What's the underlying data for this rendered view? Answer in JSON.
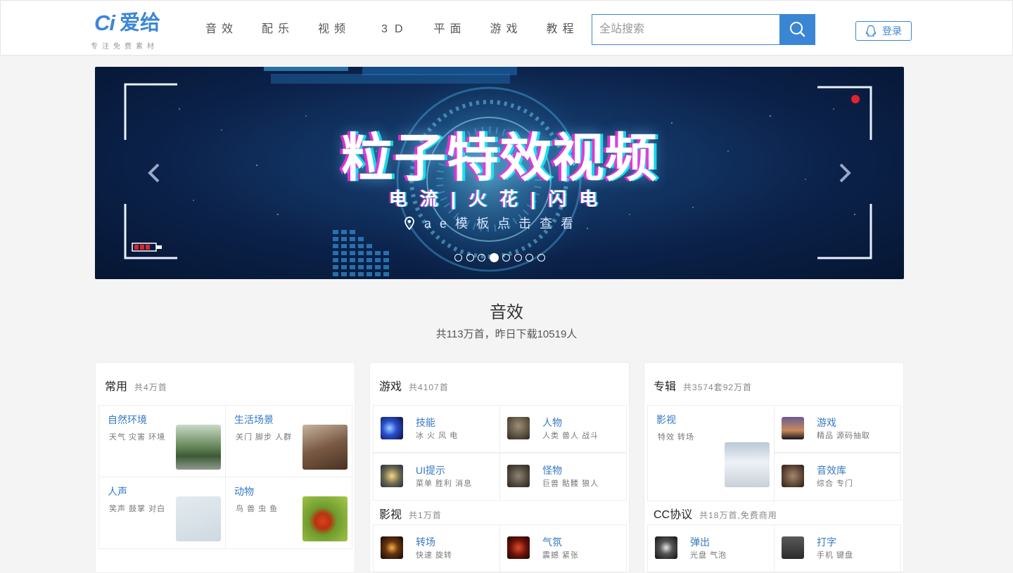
{
  "brand": {
    "mark": "Ci",
    "name": "爱给",
    "slogan": "专注免费素材"
  },
  "nav": [
    "音效",
    "配乐",
    "视频",
    "3D",
    "平面",
    "游戏",
    "教程"
  ],
  "search": {
    "placeholder": "全站搜索",
    "value": ""
  },
  "login_label": "登录",
  "banner": {
    "title": "粒子特效视频",
    "subtitle": "电流|火花|闪电",
    "location_text": "ae模板点击查看",
    "dot_count": 8,
    "active_dot": 4
  },
  "section": {
    "title": "音效",
    "subtitle": "共113万首，昨日下载10519人"
  },
  "cards": {
    "common": {
      "title": "常用",
      "count": "共4万首",
      "items": [
        {
          "name": "自然环境",
          "desc": "天气 灾害 环境"
        },
        {
          "name": "生活场景",
          "desc": "关门 脚步 人群"
        },
        {
          "name": "人声",
          "desc": "笑声 鼓掌 对白"
        },
        {
          "name": "动物",
          "desc": "鸟 兽 虫 鱼"
        }
      ]
    },
    "game": {
      "title": "游戏",
      "count": "共4107首",
      "items": [
        {
          "name": "技能",
          "desc": "冰 火 风 电"
        },
        {
          "name": "人物",
          "desc": "人类 兽人 战斗"
        },
        {
          "name": "UI提示",
          "desc": "菜单 胜利 消息"
        },
        {
          "name": "怪物",
          "desc": "巨兽 骷髅 狼人"
        }
      ],
      "sub_title": "影视",
      "sub_count": "共1万首",
      "sub_items": [
        {
          "name": "转场",
          "desc": "快速 旋转"
        },
        {
          "name": "气氛",
          "desc": "震撼 紧张"
        }
      ]
    },
    "album": {
      "title": "专辑",
      "count": "共3574套92万首",
      "items": [
        {
          "name": "影视",
          "desc": "特效 转场"
        },
        {
          "name": "游戏",
          "desc": "精品 源码抽取"
        },
        {
          "name": "音效库",
          "desc": "综合 专门"
        }
      ],
      "sub_title": "CC协议",
      "sub_count": "共18万首,免费商用",
      "sub_items": [
        {
          "name": "弹出",
          "desc": "光盘 气泡"
        },
        {
          "name": "打字",
          "desc": "手机 键盘"
        }
      ]
    }
  },
  "colors": {
    "accent": "#3b86d4",
    "link": "#3579c3",
    "banner_bg": "#0b2149"
  }
}
